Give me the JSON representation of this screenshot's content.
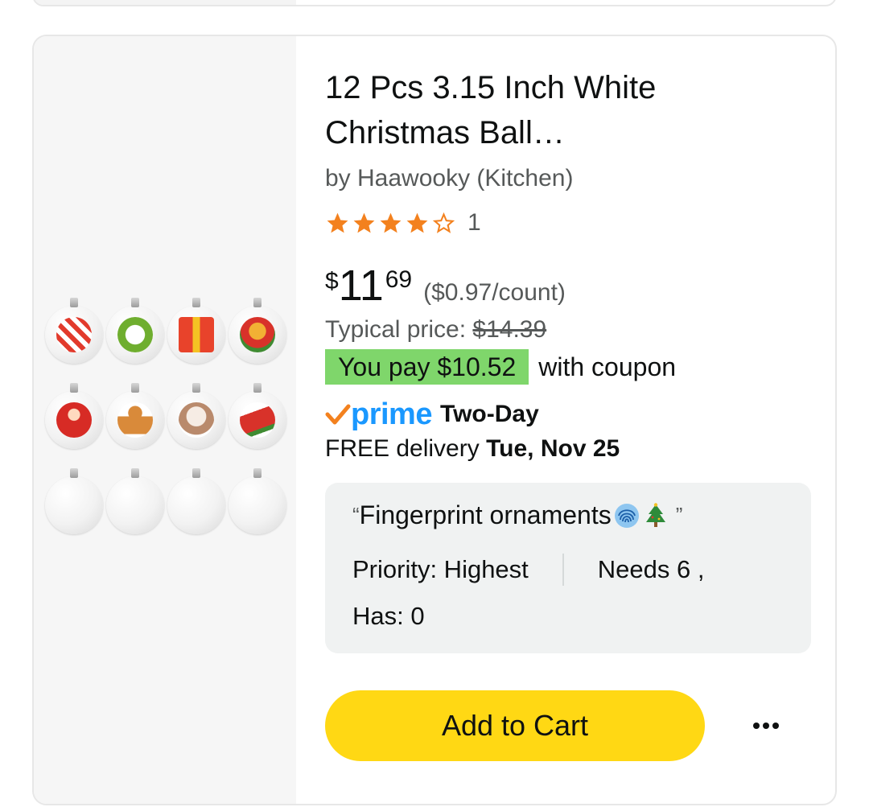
{
  "product": {
    "title": "12 Pcs 3.15 Inch White Christmas Ball…",
    "brand": "by Haawooky (Kitchen)",
    "rating": {
      "stars": 4,
      "max": 5,
      "count": "1"
    },
    "price": {
      "symbol": "$",
      "whole": "11",
      "fraction": "69",
      "unit_price": "($0.97/count)"
    },
    "typical": {
      "label": "Typical price: ",
      "value": "$14.39"
    },
    "coupon": {
      "badge": "You pay $10.52",
      "text": "with coupon"
    },
    "prime": {
      "word": "prime",
      "speed": "Two-Day"
    },
    "delivery": {
      "label": "FREE delivery",
      "date": "Tue, Nov 25"
    }
  },
  "note": {
    "open_quote": "“",
    "text": "Fingerprint ornaments",
    "close_quote": "”",
    "priority": "Priority: Highest",
    "needs": "Needs 6 ,",
    "has": "Has: 0",
    "icons": [
      "fingerprint-icon",
      "christmas-tree-icon"
    ]
  },
  "actions": {
    "add_to_cart": "Add to Cart",
    "more": "more-options-icon"
  },
  "colors": {
    "cart_button": "#ffd814",
    "coupon_badge": "#7fd66b",
    "prime_blue": "#1a98ff",
    "star": "#f3811e",
    "note_bg": "#f0f2f2"
  }
}
